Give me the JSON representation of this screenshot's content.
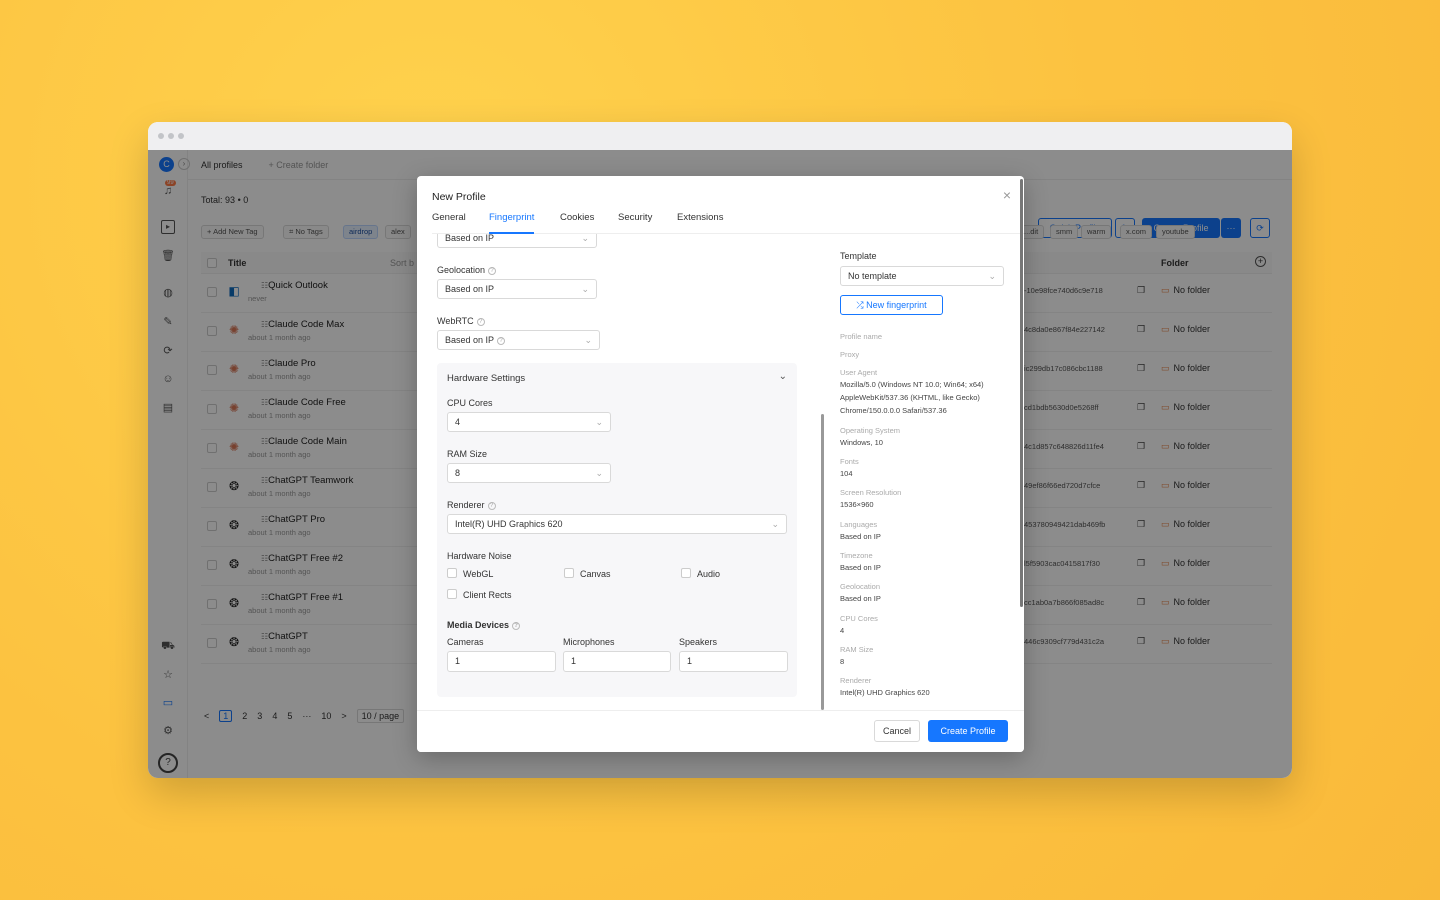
{
  "app": {
    "avatar_letter": "C",
    "badge": "99",
    "top_tabs": {
      "all_profiles": "All profiles",
      "create_folder": "Create folder"
    },
    "total_label": "Total:",
    "total_count": "93",
    "total_extra": "0",
    "buttons": {
      "quick_profile": "Quick Profile",
      "create_profile": "Create Profile",
      "more": "···"
    },
    "add_tag": "Add New Tag",
    "no_tags": "No Tags",
    "tags_left": [
      "airdrop",
      "alex"
    ],
    "tags_right": [
      "...dit",
      "smm",
      "warm",
      "x.com",
      "youtube"
    ],
    "table_headers": {
      "title": "Title",
      "sort": "Sort b",
      "folder": "Folder"
    },
    "rows": [
      {
        "name": "Quick Outlook",
        "time": "never",
        "hash": "-10e98fce740d6c9e718",
        "folder": "No folder",
        "icon": "outlook-icon",
        "icon_glyph": "◧",
        "icon_color": "#0f6cbd"
      },
      {
        "name": "Claude Code Max",
        "time": "about 1 month ago",
        "hash": "4c8da0e867f84e227142",
        "folder": "No folder",
        "icon": "claude-icon",
        "icon_glyph": "✺",
        "icon_color": "#d97757"
      },
      {
        "name": "Claude Pro",
        "time": "about 1 month ago",
        "hash": "ic299db17c086cbc1188",
        "folder": "No folder",
        "icon": "claude-icon",
        "icon_glyph": "✺",
        "icon_color": "#d97757"
      },
      {
        "name": "Claude Code Free",
        "time": "about 1 month ago",
        "hash": "cd1bdb5630d0e5268ff",
        "folder": "No folder",
        "icon": "claude-icon",
        "icon_glyph": "✺",
        "icon_color": "#d97757"
      },
      {
        "name": "Claude Code Main",
        "time": "about 1 month ago",
        "hash": "4c1d857c648826d11fe4",
        "folder": "No folder",
        "icon": "claude-icon",
        "icon_glyph": "✺",
        "icon_color": "#d97757"
      },
      {
        "name": "ChatGPT Teamwork",
        "time": "about 1 month ago",
        "hash": "49ef86f66ed720d7cfce",
        "folder": "No folder",
        "icon": "openai-icon",
        "icon_glyph": "❂",
        "icon_color": "#222222"
      },
      {
        "name": "ChatGPT Pro",
        "time": "about 1 month ago",
        "hash": "453780949421dab469fb",
        "folder": "No folder",
        "icon": "openai-icon",
        "icon_glyph": "❂",
        "icon_color": "#222222"
      },
      {
        "name": "ChatGPT Free #2",
        "time": "about 1 month ago",
        "hash": "l5f5903cac0415817f30",
        "folder": "No folder",
        "icon": "openai-icon",
        "icon_glyph": "❂",
        "icon_color": "#222222"
      },
      {
        "name": "ChatGPT Free #1",
        "time": "about 1 month ago",
        "hash": "cc1ab0a7b866f085ad8c",
        "folder": "No folder",
        "icon": "openai-icon",
        "icon_glyph": "❂",
        "icon_color": "#222222"
      },
      {
        "name": "ChatGPT",
        "time": "about 1 month ago",
        "hash": "446c9309cf779d431c2a",
        "folder": "No folder",
        "icon": "openai-icon",
        "icon_glyph": "❂",
        "icon_color": "#222222"
      }
    ],
    "pagination": {
      "prev": "<",
      "pages": [
        "1",
        "2",
        "3",
        "4",
        "5"
      ],
      "ellipsis": "···",
      "last": "10",
      "next": ">",
      "page_size": "10 / page"
    }
  },
  "modal": {
    "title": "New Profile",
    "close": "×",
    "tabs": [
      "General",
      "Fingerprint",
      "Cookies",
      "Security",
      "Extensions"
    ],
    "active_tab": "Fingerprint",
    "top_select": "Based on IP",
    "geolocation": {
      "label": "Geolocation",
      "value": "Based on IP"
    },
    "webrtc": {
      "label": "WebRTC",
      "value": "Based on IP"
    },
    "hardware": {
      "title": "Hardware Settings",
      "cpu_label": "CPU Cores",
      "cpu_value": "4",
      "ram_label": "RAM Size",
      "ram_value": "8",
      "renderer_label": "Renderer",
      "renderer_value": "Intel(R) UHD Graphics 620",
      "noise_label": "Hardware Noise",
      "noise": [
        "WebGL",
        "Canvas",
        "Audio",
        "Client Rects"
      ],
      "media_label": "Media Devices",
      "cameras_label": "Cameras",
      "cameras_value": "1",
      "mics_label": "Microphones",
      "mics_value": "1",
      "speakers_label": "Speakers",
      "speakers_value": "1"
    },
    "template": {
      "label": "Template",
      "value": "No template",
      "new_fp": "New fingerprint"
    },
    "summary": {
      "profile_name": "Profile name",
      "proxy": "Proxy",
      "ua_label": "User Agent",
      "ua_lines": [
        "Mozilla/5.0 (Windows NT 10.0; Win64; x64)",
        "AppleWebKit/537.36 (KHTML, like Gecko)",
        "Chrome/150.0.0.0 Safari/537.36"
      ],
      "os_label": "Operating System",
      "os_value": "Windows, 10",
      "fonts_label": "Fonts",
      "fonts_value": "104",
      "res_label": "Screen Resolution",
      "res_value": "1536×960",
      "lang_label": "Languages",
      "lang_value": "Based on IP",
      "tz_label": "Timezone",
      "tz_value": "Based on IP",
      "geo_label": "Geolocation",
      "geo_value": "Based on IP",
      "cpu_label": "CPU Cores",
      "cpu_value": "4",
      "ram_label": "RAM Size",
      "ram_value": "8",
      "renderer_label": "Renderer",
      "renderer_value": "Intel(R) UHD Graphics 620"
    },
    "footer": {
      "cancel": "Cancel",
      "create": "Create Profile"
    }
  },
  "colors": {
    "accent": "#1677ff",
    "background": "#fcc240"
  }
}
